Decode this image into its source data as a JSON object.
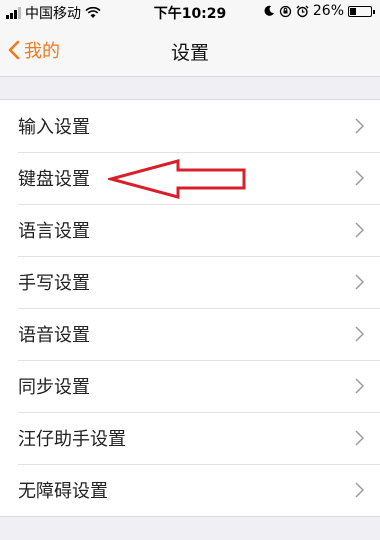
{
  "status_bar": {
    "carrier": "中国移动",
    "time": "下午10:29",
    "battery": "26%",
    "battery_level": 0.26
  },
  "nav": {
    "back_label": "我的",
    "title": "设置"
  },
  "settings_items": [
    {
      "label": "输入设置"
    },
    {
      "label": "键盘设置"
    },
    {
      "label": "语言设置"
    },
    {
      "label": "手写设置"
    },
    {
      "label": "语音设置"
    },
    {
      "label": "同步设置"
    },
    {
      "label": "汪仔助手设置"
    },
    {
      "label": "无障碍设置"
    }
  ],
  "colors": {
    "accent": "#f07a1c",
    "annotation_arrow": "#d7202a"
  },
  "icons": {
    "back": "chevron-left-icon",
    "row": "chevron-right-icon"
  }
}
